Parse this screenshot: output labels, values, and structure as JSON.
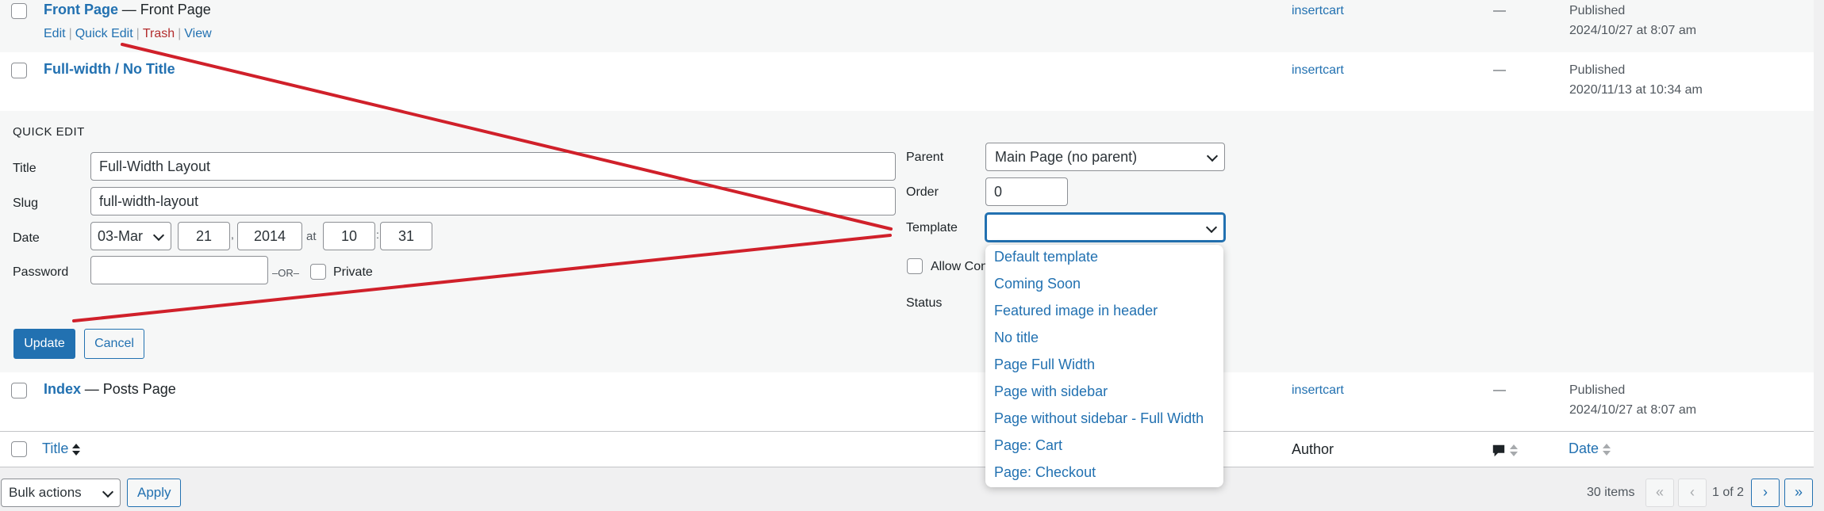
{
  "rows": [
    {
      "title": "Front Page",
      "suffix": "— Front Page",
      "actions": {
        "edit": "Edit",
        "quick_edit": "Quick Edit",
        "trash": "Trash",
        "view": "View"
      },
      "author": "insertcart",
      "comments": "—",
      "status": "Published",
      "date": "2024/10/27 at 8:07 am"
    },
    {
      "title": "Full-width / No Title",
      "author": "insertcart",
      "comments": "—",
      "status": "Published",
      "date": "2020/11/13 at 10:34 am"
    },
    {
      "title": "Index",
      "suffix": "— Posts Page",
      "author": "insertcart",
      "comments": "—",
      "status": "Published",
      "date": "2024/10/27 at 8:07 am"
    }
  ],
  "quick_edit": {
    "heading": "QUICK EDIT",
    "title_label": "Title",
    "title_value": "Full-Width Layout",
    "slug_label": "Slug",
    "slug_value": "full-width-layout",
    "date_label": "Date",
    "month": "03-Mar",
    "day": "21",
    "comma": ",",
    "year": "2014",
    "at": "at",
    "hour": "10",
    "colon": ":",
    "minute": "31",
    "password_label": "Password",
    "password_value": "",
    "or_text": "–OR–",
    "private_label": "Private",
    "parent_label": "Parent",
    "parent_value": "Main Page (no parent)",
    "order_label": "Order",
    "order_value": "0",
    "template_label": "Template",
    "template_value": "",
    "allow_comments_label": "Allow Con",
    "status_label": "Status",
    "update_button": "Update",
    "cancel_button": "Cancel"
  },
  "template_options": [
    "Default template",
    "Coming Soon",
    "Featured image in header",
    "No title",
    "Page Full Width",
    "Page with sidebar",
    "Page without sidebar - Full Width",
    "Page: Cart",
    "Page: Checkout"
  ],
  "footer_header": {
    "title": "Title",
    "author": "Author",
    "date": "Date",
    "comments_icon": "comment-bubble-icon"
  },
  "bottom_bar": {
    "bulk_actions": "Bulk actions",
    "apply": "Apply",
    "items_count": "30 items",
    "first": "«",
    "prev": "‹",
    "page_info": "1 of 2",
    "next": "›",
    "last": "»"
  },
  "annotation_color": "#d0202a"
}
